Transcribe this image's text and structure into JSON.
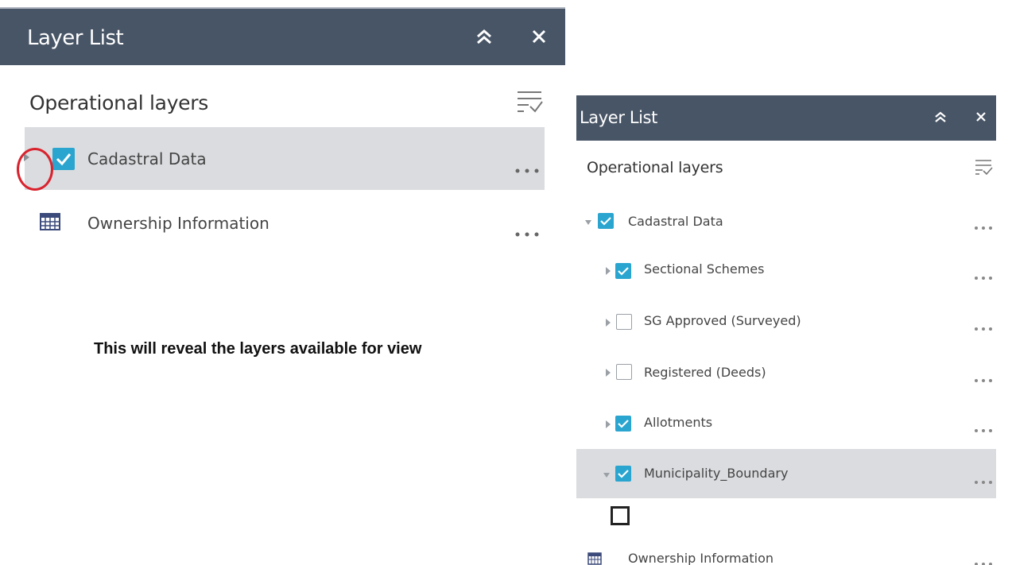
{
  "left_panel": {
    "title": "Layer List",
    "section_title": "Operational layers",
    "layers": [
      {
        "label": "Cadastral Data",
        "checked": true,
        "selected": true
      },
      {
        "label": "Ownership Information",
        "type": "table"
      }
    ]
  },
  "caption": "This will reveal the layers available for view",
  "right_panel": {
    "title": "Layer List",
    "section_title": "Operational layers",
    "layers": [
      {
        "label": "Cadastral Data",
        "checked": true,
        "expanded": true
      },
      {
        "label": "Sectional Schemes",
        "checked": true
      },
      {
        "label": "SG Approved (Surveyed)",
        "checked": false
      },
      {
        "label": "Registered (Deeds)",
        "checked": false
      },
      {
        "label": "Allotments",
        "checked": true
      },
      {
        "label": "Municipality_Boundary",
        "checked": true,
        "expanded": true,
        "selected": true
      },
      {
        "label": "Ownership Information",
        "type": "table"
      }
    ]
  },
  "icons": {
    "collapse": "double-chevron-up-icon",
    "close": "close-icon",
    "filter": "filter-list-icon",
    "expand": "caret-right-icon",
    "expanded": "caret-down-icon",
    "more": "more-dots-icon",
    "table": "table-icon",
    "checkbox": "checkmark-icon",
    "highlight": "red-circle-annotation"
  },
  "colors": {
    "header_bg": "#485566",
    "checkbox_blue": "#2aa5cf",
    "selected_row": "#dadcdf",
    "annotation_red": "#d9232e"
  }
}
